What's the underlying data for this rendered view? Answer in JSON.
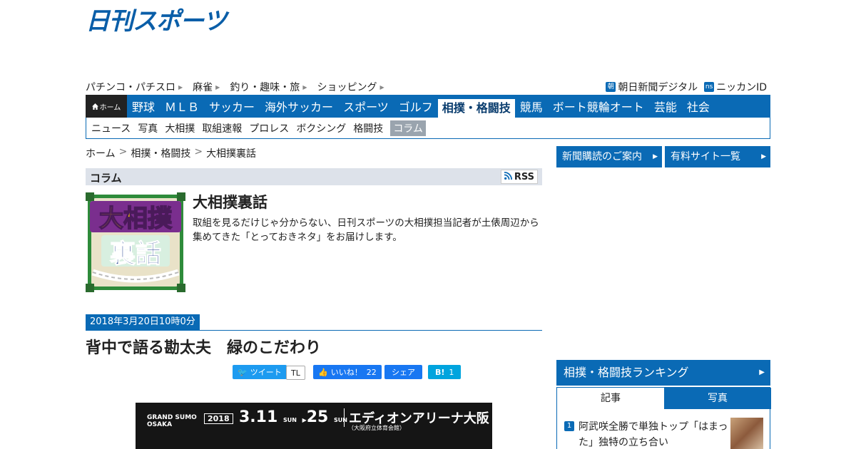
{
  "header": {
    "logo_text": "日刊スポーツ",
    "top_links": [
      "パチンコ・パチスロ",
      "麻雀",
      "釣り・趣味・旅",
      "ショッピング"
    ],
    "right_links": [
      {
        "icon": "朝",
        "label": "朝日新聞デジタル"
      },
      {
        "icon": "ns",
        "label": "ニッカンID"
      }
    ]
  },
  "nav": {
    "home_label": "ホーム",
    "items": [
      "野球",
      "ＭＬＢ",
      "サッカー",
      "海外サッカー",
      "スポーツ",
      "ゴルフ",
      "相撲・格闘技",
      "競馬",
      "ボート競輪オート",
      "芸能",
      "社会"
    ],
    "active_index": 6,
    "sub_items": [
      "ニュース",
      "写真",
      "大相撲",
      "取組速報",
      "プロレス",
      "ボクシング",
      "格闘技",
      "コラム"
    ],
    "sub_active_index": 7
  },
  "breadcrumb": {
    "items": [
      "ホーム",
      "相撲・格闘技",
      "大相撲裏話"
    ],
    "separator": ">"
  },
  "column": {
    "header": "コラム",
    "rss_label": "RSS",
    "logo_text": [
      "大相撲",
      "裏話"
    ],
    "title": "大相撲裏話",
    "description": "取組を見るだけじゃ分からない、日刊スポーツの大相撲担当記者が土俵周辺から集めてきた「とっておきネタ」をお届けします。"
  },
  "article": {
    "date": "2018年3月20日10時0分",
    "headline": "背中で語る勘太夫　緑のこだわり"
  },
  "social": {
    "tweet_label": "ツイート",
    "tl_label": "TL",
    "like_label": "いいね！",
    "like_count": "22",
    "share_label": "シェア",
    "hatena_label": "B!",
    "hatena_count": "1"
  },
  "banner": {
    "brand": "GRAND SUMO\nOSAKA",
    "year": "2018",
    "start": "3.11",
    "start_day": "SUN",
    "arrow": "▶",
    "end": "25",
    "end_day": "SUN",
    "venue": "エディオンアリーナ大阪",
    "venue_sub": "（大阪府立体育会館）"
  },
  "sidebar": {
    "buttons": [
      "新聞購読のご案内",
      "有料サイト一覧"
    ],
    "ranking_title": "相撲・格闘技ランキング",
    "tabs": [
      "記事",
      "写真"
    ],
    "ranking_items": [
      {
        "rank": "1",
        "text": "阿武咲全勝で単独トップ「はまった」独特の立ち合い"
      }
    ]
  },
  "colors": {
    "brand_blue": "#0a6ab5",
    "logo_blue": "#0a5ea8",
    "column_header_bg": "#dde2ea"
  }
}
